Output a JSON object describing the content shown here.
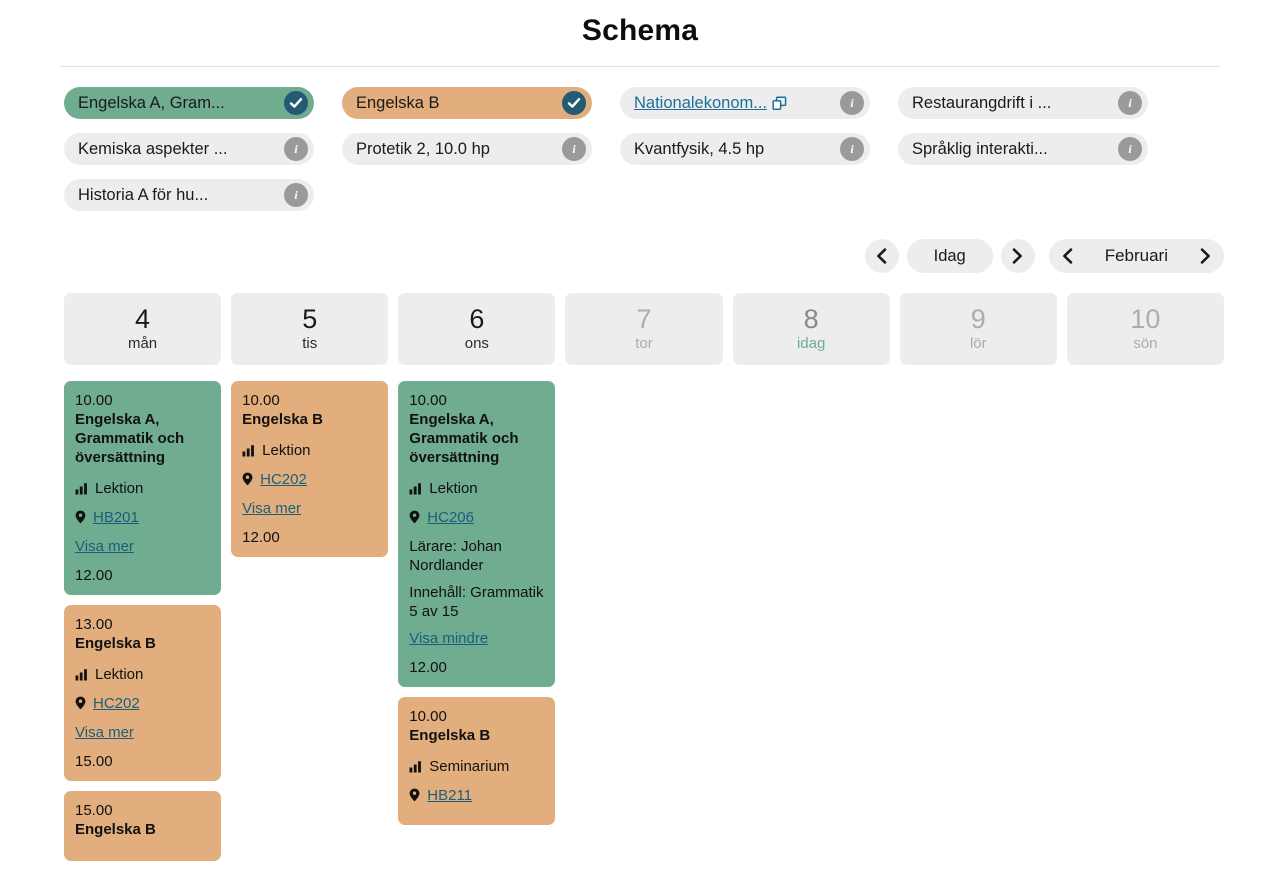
{
  "header": {
    "title": "Schema"
  },
  "courses": [
    {
      "label": "Engelska A, Gram...",
      "style": "green",
      "badge": "check",
      "link": false,
      "ext": false
    },
    {
      "label": "Engelska B",
      "style": "orange",
      "badge": "check",
      "link": false,
      "ext": false
    },
    {
      "label": "Nationalekonom...",
      "style": "plain",
      "badge": "info",
      "link": true,
      "ext": true
    },
    {
      "label": "Restaurangdrift i ...",
      "style": "plain",
      "badge": "info",
      "link": false,
      "ext": false
    },
    {
      "label": "Kemiska aspekter ...",
      "style": "plain",
      "badge": "info",
      "link": false,
      "ext": false
    },
    {
      "label": "Protetik 2, 10.0 hp",
      "style": "plain",
      "badge": "info",
      "link": false,
      "ext": false
    },
    {
      "label": "Kvantfysik, 4.5 hp",
      "style": "plain",
      "badge": "info",
      "link": false,
      "ext": false
    },
    {
      "label": "Språklig interakti...",
      "style": "plain",
      "badge": "info",
      "link": false,
      "ext": false
    },
    {
      "label": "Historia A för hu...",
      "style": "plain",
      "badge": "info",
      "link": false,
      "ext": false
    }
  ],
  "nav": {
    "prev_day_icon": "chevron-left-icon",
    "today_label": "Idag",
    "next_day_icon": "chevron-right-icon",
    "prev_month_icon": "chevron-left-icon",
    "month_label": "Februari",
    "next_month_icon": "chevron-right-icon"
  },
  "days": [
    {
      "num": "4",
      "name": "mån",
      "state": "active"
    },
    {
      "num": "5",
      "name": "tis",
      "state": "active"
    },
    {
      "num": "6",
      "name": "ons",
      "state": "active"
    },
    {
      "num": "7",
      "name": "tor",
      "state": "muted"
    },
    {
      "num": "8",
      "name": "idag",
      "state": "today"
    },
    {
      "num": "9",
      "name": "lör",
      "state": "muted"
    },
    {
      "num": "10",
      "name": "sön",
      "state": "muted"
    }
  ],
  "columns": [
    {
      "events": [
        {
          "style": "green",
          "start": "10.00",
          "title": "Engelska A, Grammatik och översättning",
          "type": "Lektion",
          "location": "HB201",
          "details": [],
          "toggle": "Visa mer",
          "end": "12.00"
        },
        {
          "style": "orange",
          "start": "13.00",
          "title": "Engelska B",
          "type": "Lektion",
          "location": "HC202",
          "details": [],
          "toggle": "Visa mer",
          "end": "15.00"
        },
        {
          "style": "orange",
          "start": "15.00",
          "title": "Engelska B",
          "type": "",
          "location": "",
          "details": [],
          "toggle": "",
          "end": ""
        }
      ]
    },
    {
      "events": [
        {
          "style": "orange",
          "start": "10.00",
          "title": "Engelska B",
          "type": "Lektion",
          "location": "HC202",
          "details": [],
          "toggle": "Visa mer",
          "end": "12.00"
        }
      ]
    },
    {
      "events": [
        {
          "style": "green",
          "start": "10.00",
          "title": "Engelska A, Grammatik och översättning",
          "type": "Lektion",
          "location": "HC206",
          "details": [
            "Lärare: Johan Nordlander",
            "Innehåll: Grammatik 5 av 15"
          ],
          "toggle": "Visa mindre",
          "end": "12.00"
        },
        {
          "style": "orange",
          "start": "10.00",
          "title": "Engelska B",
          "type": "Seminarium",
          "location": "HB211",
          "details": [],
          "toggle": "",
          "end": ""
        }
      ]
    },
    {
      "events": []
    },
    {
      "events": []
    },
    {
      "events": []
    },
    {
      "events": []
    }
  ]
}
